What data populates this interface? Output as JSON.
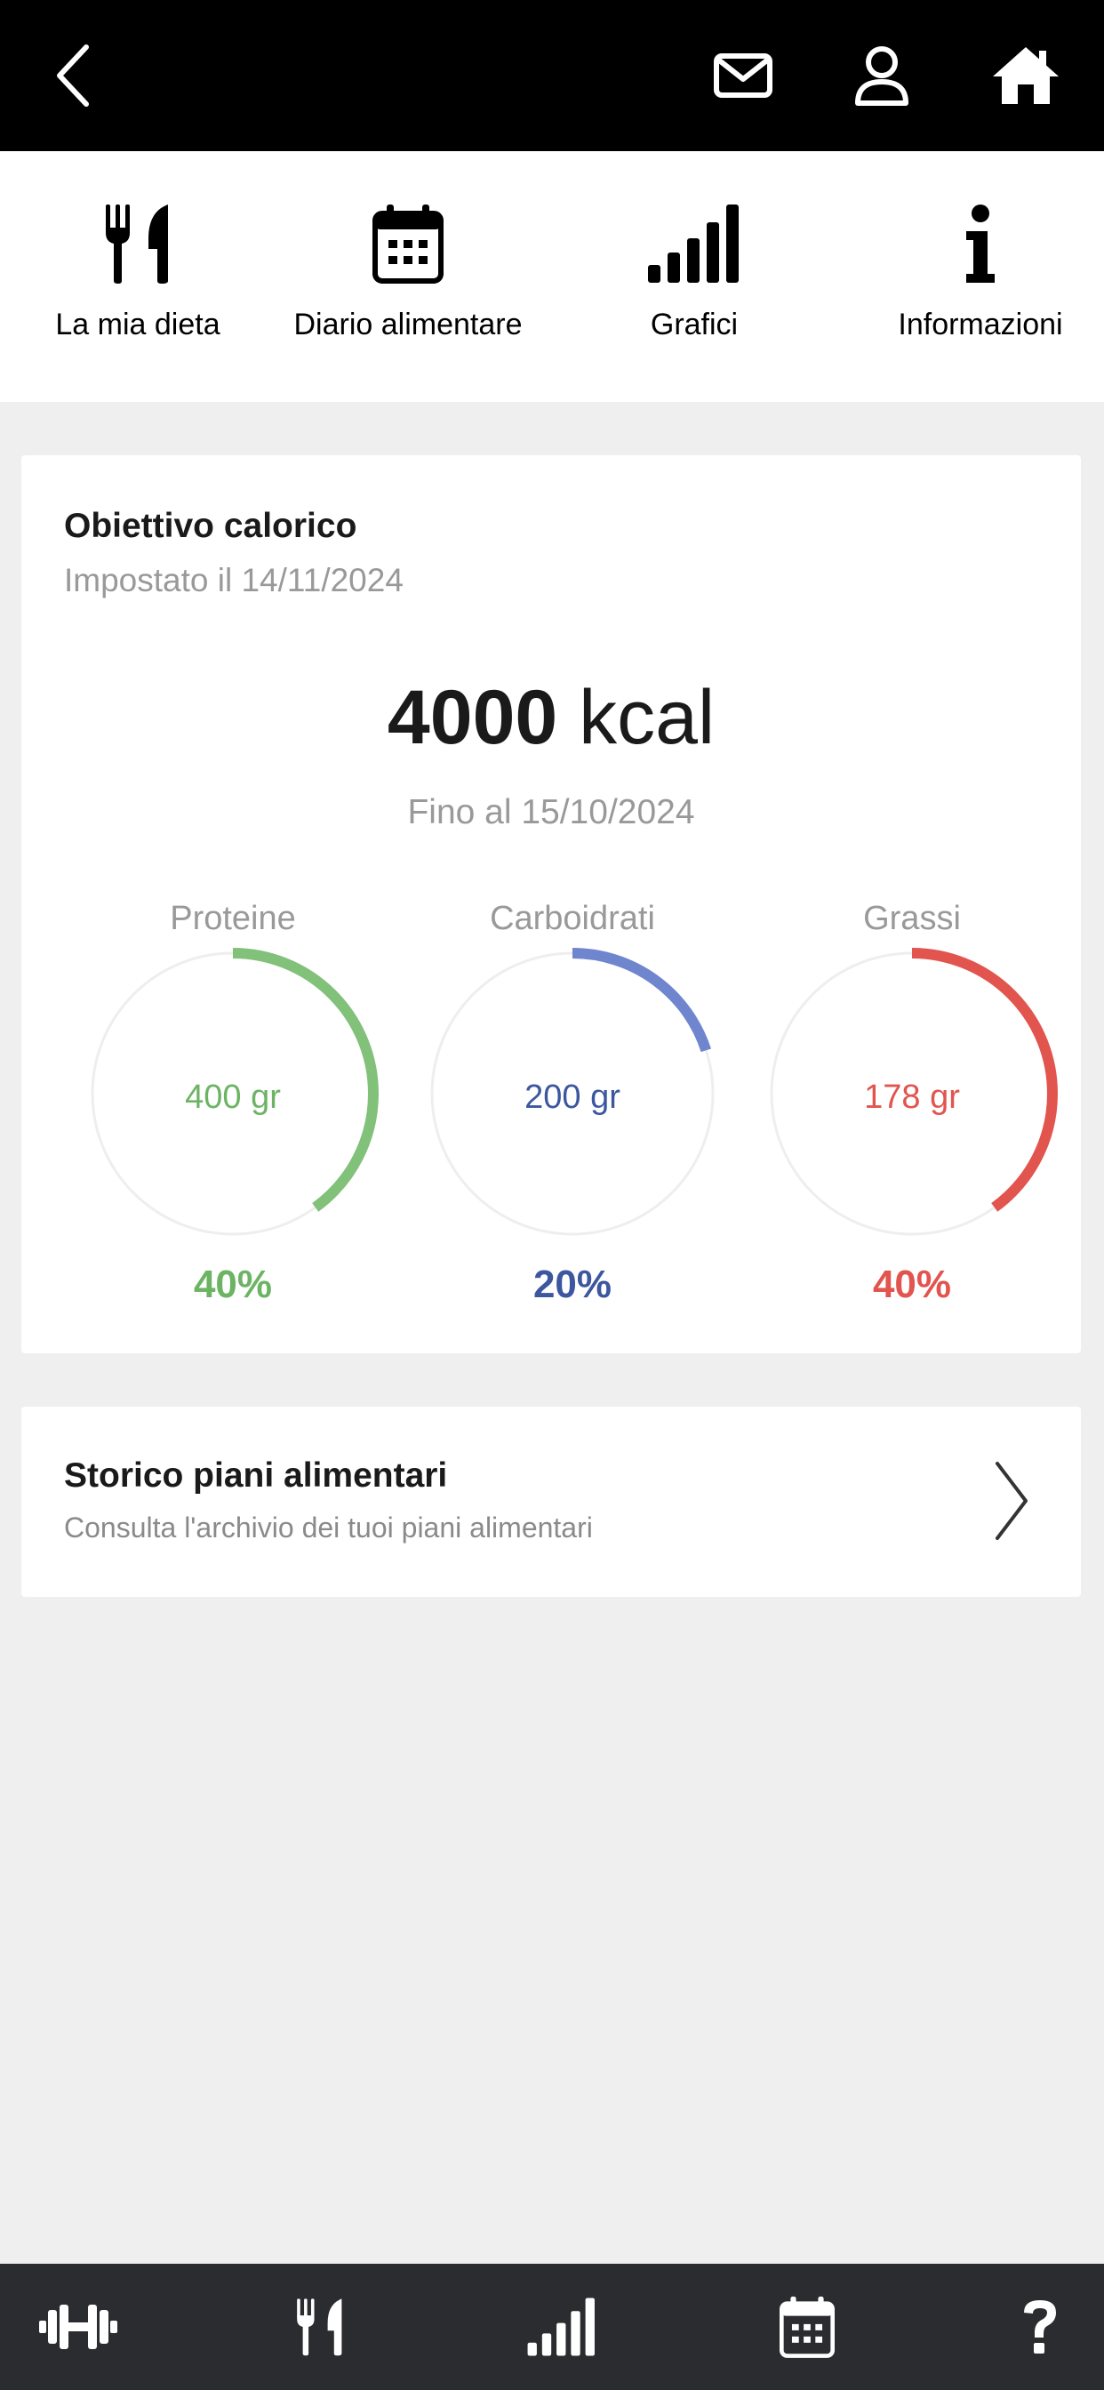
{
  "header": {
    "icons": [
      "chevron-left-icon",
      "mail-icon",
      "user-icon",
      "home-icon"
    ]
  },
  "tabs": [
    {
      "label": "La mia dieta",
      "icon": "fork-knife-icon"
    },
    {
      "label": "Diario alimentare",
      "icon": "calendar-icon"
    },
    {
      "label": "Grafici",
      "icon": "signal-bars-icon"
    },
    {
      "label": "Informazioni",
      "icon": "info-icon"
    }
  ],
  "goal": {
    "title": "Obiettivo calorico",
    "set_on": "Impostato il 14/11/2024",
    "kcal_value": "4000",
    "kcal_unit": "kcal",
    "until": "Fino al 15/10/2024",
    "macros": [
      {
        "name": "Proteine",
        "amount": "400 gr",
        "percent_label": "40%",
        "fraction": 0.4,
        "color": "#81c17a",
        "text_color": "#6cb464"
      },
      {
        "name": "Carboidrati",
        "amount": "200 gr",
        "percent_label": "20%",
        "fraction": 0.2,
        "color": "#6f86cf",
        "text_color": "#3d56a0"
      },
      {
        "name": "Grassi",
        "amount": "178 gr",
        "percent_label": "40%",
        "fraction": 0.4,
        "color": "#e2544e",
        "text_color": "#e2544e"
      }
    ]
  },
  "history": {
    "title": "Storico piani alimentari",
    "subtitle": "Consulta l'archivio dei tuoi piani alimentari"
  },
  "bottom_nav": {
    "icons": [
      "dumbbell-icon",
      "fork-knife-icon",
      "signal-bars-icon",
      "calendar-icon",
      "question-icon"
    ]
  },
  "colors": {
    "header_bg": "#000000",
    "bottom_bar_bg": "#2a2c2f",
    "page_bg": "#efefef",
    "ring_track": "#eeeeee"
  }
}
